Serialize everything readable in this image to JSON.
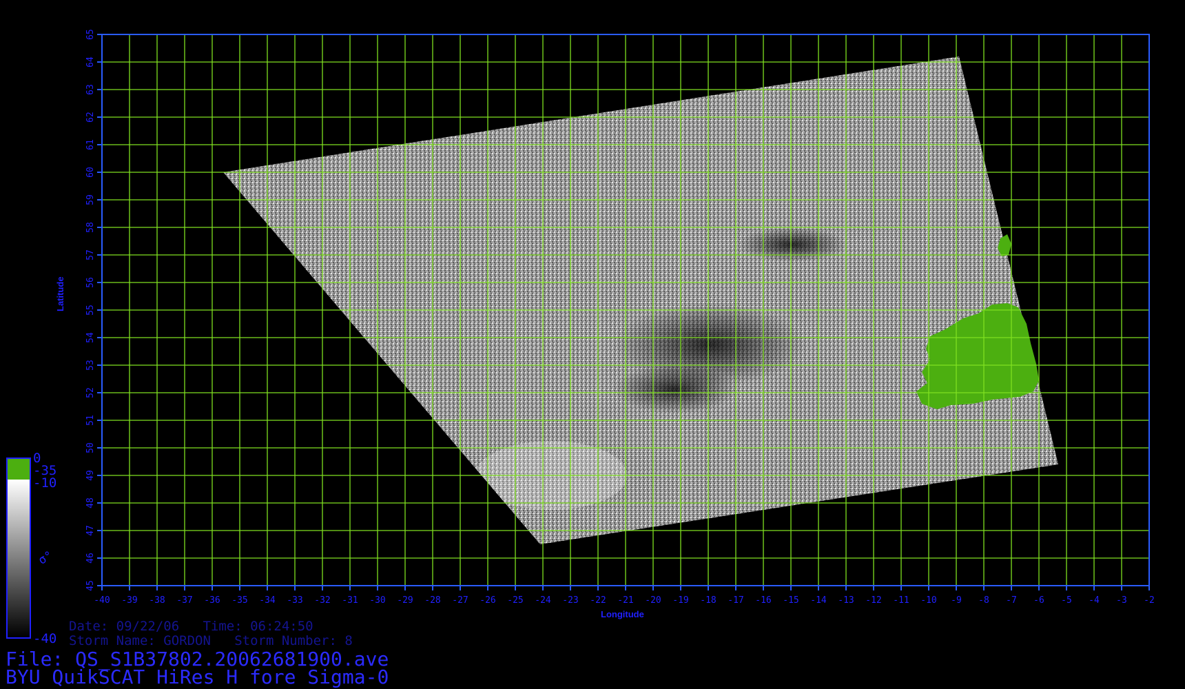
{
  "map": {
    "xaxis_label": "Longitude",
    "yaxis_label": "Latitude",
    "x_ticks": [
      "-40",
      "-39",
      "-38",
      "-37",
      "-36",
      "-35",
      "-34",
      "-33",
      "-32",
      "-31",
      "-30",
      "-29",
      "-28",
      "-27",
      "-26",
      "-25",
      "-24",
      "-23",
      "-22",
      "-21",
      "-20",
      "-19",
      "-18",
      "-17",
      "-16",
      "-15",
      "-14",
      "-13",
      "-12",
      "-11",
      "-10",
      "-9",
      "-8",
      "-7",
      "-6",
      "-5",
      "-4",
      "-3",
      "-2"
    ],
    "y_ticks": [
      "45",
      "46",
      "47",
      "48",
      "49",
      "50",
      "51",
      "52",
      "53",
      "54",
      "55",
      "56",
      "57",
      "58",
      "59",
      "60",
      "61",
      "62",
      "63",
      "64",
      "65"
    ],
    "lon_range": [
      -40,
      -2
    ],
    "lat_range": [
      45,
      65
    ],
    "grid": true,
    "grid_color": "#7fe020",
    "frame_color": "#2a5cff",
    "swath_corners_lonlat": [
      [
        -35.6,
        60.0
      ],
      [
        -8.9,
        64.2
      ],
      [
        -5.3,
        49.4
      ],
      [
        -24.1,
        46.5
      ]
    ],
    "land_color": "#4caf10"
  },
  "colorbar": {
    "labels": [
      "0",
      "-35",
      "-10",
      "-40"
    ],
    "symbol": "σ°",
    "land_color": "#4caf10",
    "gradient_top": "#ffffff",
    "gradient_bottom": "#000000",
    "border_color": "#2020ff"
  },
  "meta": {
    "date_line": "Date: 09/22/06   Time: 06:24:50",
    "storm_line": "Storm Name: GORDON   Storm Number: 8",
    "file_line": "File: QS_S1B37802.20062681900.ave",
    "product_line": "BYU QuikSCAT HiRes H fore Sigma-0"
  }
}
